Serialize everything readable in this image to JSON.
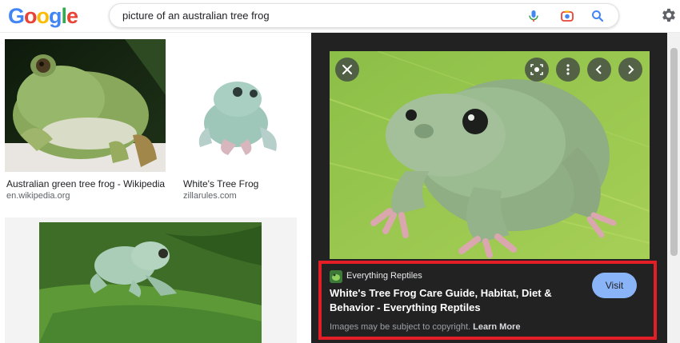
{
  "header": {
    "logo_letters": [
      {
        "ch": "G",
        "color": "#4285F4"
      },
      {
        "ch": "o",
        "color": "#EA4335"
      },
      {
        "ch": "o",
        "color": "#FBBC05"
      },
      {
        "ch": "g",
        "color": "#4285F4"
      },
      {
        "ch": "l",
        "color": "#34A853"
      },
      {
        "ch": "e",
        "color": "#EA4335"
      }
    ],
    "search_query": "picture of an australian tree frog",
    "icons": [
      "mic-icon",
      "camera-lens-icon",
      "search-icon",
      "settings-gear-icon"
    ]
  },
  "results": [
    {
      "title": "Australian green tree frog - Wikipedia",
      "domain": "en.wikipedia.org"
    },
    {
      "title": "White's Tree Frog",
      "domain": "zillarules.com"
    }
  ],
  "preview": {
    "controls": [
      "close-icon",
      "lens-icon",
      "more-vert-icon",
      "prev-icon",
      "next-icon"
    ],
    "source_name": "Everything Reptiles",
    "title": "White's Tree Frog Care Guide, Habitat, Diet & Behavior - Everything Reptiles",
    "visit_label": "Visit",
    "copyright_text": "Images may be subject to copyright.",
    "learn_more": "Learn More"
  },
  "colors": {
    "panel_bg": "#222222",
    "visit_bg": "#8ab4f8",
    "highlight_border": "#e41e26"
  }
}
